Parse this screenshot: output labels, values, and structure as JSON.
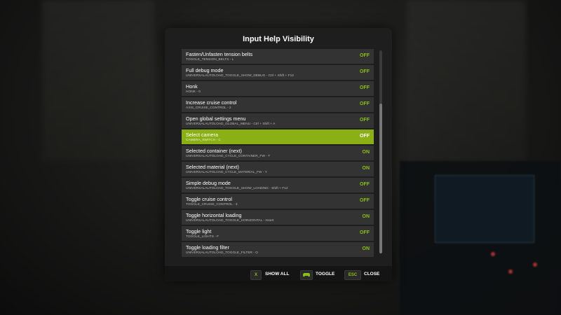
{
  "dialog": {
    "title": "Input Help Visibility"
  },
  "actions": [
    {
      "title": "Fasten/Unfasten tension belts",
      "binding": "TOGGLE_TENSION_BELTS - L",
      "value": "OFF",
      "selected": false
    },
    {
      "title": "Full debug mode",
      "binding": "UNIVERSALAUTOLOAD_TOGGLE_SHOW_DEBUG - Ctrl + Shift + F12",
      "value": "OFF",
      "selected": false
    },
    {
      "title": "Honk",
      "binding": "HONK - 0",
      "value": "OFF",
      "selected": false
    },
    {
      "title": "Increase cruise control",
      "binding": "AXIS_CRUISE_CONTROL - 2",
      "value": "OFF",
      "selected": false
    },
    {
      "title": "Open global settings menu",
      "binding": "UNIVERSALAUTOLOAD_GLOBAL_MENU - Ctrl + Shift + A",
      "value": "OFF",
      "selected": false
    },
    {
      "title": "Select camera",
      "binding": "CAMERA_SWITCH - C",
      "value": "OFF",
      "selected": true
    },
    {
      "title": "Selected container (next)",
      "binding": "UNIVERSALAUTOLOAD_CYCLE_CONTAINER_FW - T",
      "value": "ON",
      "selected": false
    },
    {
      "title": "Selected material (next)",
      "binding": "UNIVERSALAUTOLOAD_CYCLE_MATERIAL_FW - Y",
      "value": "ON",
      "selected": false
    },
    {
      "title": "Simple debug mode",
      "binding": "UNIVERSALAUTOLOAD_TOGGLE_SHOW_LOADING - Shift + F12",
      "value": "OFF",
      "selected": false
    },
    {
      "title": "Toggle cruise control",
      "binding": "TOGGLE_CRUISE_CONTROL - 3",
      "value": "OFF",
      "selected": false
    },
    {
      "title": "Toggle horizontal loading",
      "binding": "UNIVERSALAUTOLOAD_TOGGLE_HORIZONTAL - Insert",
      "value": "ON",
      "selected": false
    },
    {
      "title": "Toggle light",
      "binding": "TOGGLE_LIGHTS - F",
      "value": "OFF",
      "selected": false
    },
    {
      "title": "Toggle loading filter",
      "binding": "UNIVERSALAUTOLOAD_TOGGLE_FILTER - O",
      "value": "ON",
      "selected": false
    }
  ],
  "footer": {
    "show_all_key": "X",
    "show_all_label": "SHOW ALL",
    "toggle_icon": "gamepad-icon",
    "toggle_label": "TOGGLE",
    "close_key": "ESC",
    "close_label": "CLOSE"
  },
  "colors": {
    "accent": "#8bb015",
    "value_text": "#8bbf17",
    "row_bg": "#333333",
    "panel_bg": "#1e1e1e"
  }
}
